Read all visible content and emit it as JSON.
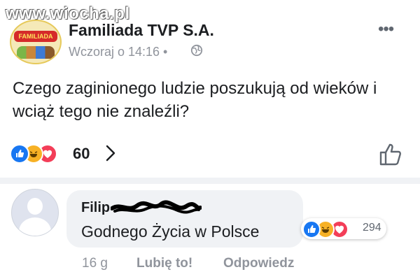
{
  "watermark": {
    "text": "www.wiocha.pl"
  },
  "post": {
    "page_name": "Familiada TVP S.A.",
    "avatar_text": "FAMILIADA",
    "time": "Wczoraj o 14:16 •",
    "globe_icon": "globe-icon",
    "more_icon": "•••",
    "text": "Czego zaginionego ludzie poszukują od wieków i wciąż tego nie znaleźli?",
    "reactions": {
      "icons": [
        "like-icon",
        "haha-icon",
        "love-icon"
      ],
      "count": "60"
    }
  },
  "comment": {
    "author": "Filip",
    "text": "Godnego Życia w Polsce",
    "reactions": {
      "icons": [
        "like-icon",
        "haha-icon",
        "love-icon"
      ],
      "count": "294"
    },
    "age": "16 g",
    "like_label": "Lubię to!",
    "reply_label": "Odpowiedz"
  },
  "colors": {
    "like_blue": "#1877f2",
    "haha_yellow": "#f7b125",
    "love_red": "#f33e58",
    "meta_gray": "#90949c",
    "bubble_gray": "#f0f2f5"
  }
}
